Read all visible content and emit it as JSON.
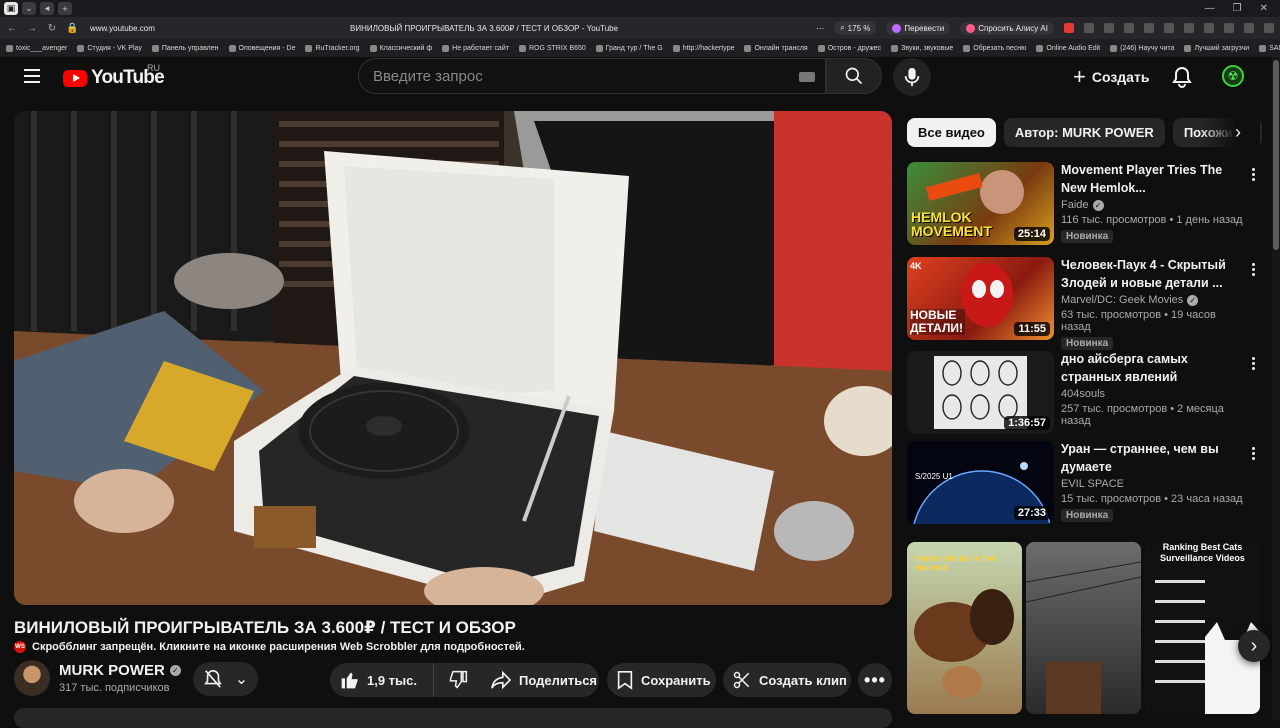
{
  "browser": {
    "url": "www.youtube.com",
    "page_title": "ВИНИЛОВЫЙ ПРОИГРЫВАТЕЛЬ ЗА 3.600₽ / ТЕСТ И ОБЗОР - YouTube",
    "zoom": "175 %",
    "translate_label": "Перевести",
    "alice_label": "Спросить Алису AI",
    "bookmarks": [
      "toxic___avenger",
      "Студия - VK Play",
      "Панель управлен",
      "Оповещения - De",
      "RuTracker.org",
      "Классический ф",
      "Не работает сайт",
      "ROG STRIX B650",
      "Гранд тур / The G",
      "http://hackertype",
      "Онлайн трансля",
      "Остров - дружес",
      "Звуки, звуковые",
      "Обрезать песню",
      "Online Audio Edit",
      "(246) Научу чита",
      "Лучший загрузчи",
      "SAN_VENCII"
    ]
  },
  "header": {
    "logo_text": "YouTube",
    "region": "RU",
    "search_placeholder": "Введите запрос",
    "create_label": "Создать"
  },
  "video": {
    "title": "ВИНИЛОВЫЙ ПРОИГРЫВАТЕЛЬ ЗА 3.600₽ / ТЕСТ И ОБЗОР",
    "scrobble_notice": "Скробблинг запрещён. Кликните на иконке расширения Web Scrobbler для подробностей.",
    "scrobble_icon_text": "WS",
    "channel_name": "MURK POWER",
    "subscribers": "317 тыс. подписчиков",
    "likes": "1,9 тыс.",
    "share_label": "Поделиться",
    "save_label": "Сохранить",
    "clip_label": "Создать клип"
  },
  "chips": [
    "Все видео",
    "Автор: MURK POWER",
    "Похожий к"
  ],
  "recommendations": [
    {
      "title": "Movement Player Tries The New Hemlok...",
      "channel": "Faide",
      "verified": true,
      "stats": "116 тыс. просмотров • 1 день назад",
      "badge": "Новинка",
      "duration": "25:14",
      "thumb_text": "HEMLOK MOVEMENT"
    },
    {
      "title": "Человек-Паук 4 - Скрытый Злодей и новые детали ...",
      "channel": "Marvel/DC: Geek Movies",
      "verified": true,
      "stats": "63 тыс. просмотров • 19 часов назад",
      "badge": "Новинка",
      "duration": "11:55",
      "thumb_text": "НОВЫЕ ДЕТАЛИ!"
    },
    {
      "title": "дно айсберга самых странных явлений",
      "channel": "404souls",
      "verified": false,
      "stats": "257 тыс. просмотров • 2 месяца назад",
      "badge": "",
      "duration": "1:36:57",
      "thumb_text": ""
    },
    {
      "title": "Уран — страннее, чем вы думаете",
      "channel": "EVIL SPACE",
      "verified": false,
      "stats": "15 тыс. просмотров • 23 часа назад",
      "badge": "Новинка",
      "duration": "27:33",
      "thumb_text": "S/2025 U1"
    }
  ],
  "shorts": [
    {
      "caption": "Horse defends in five seconds"
    },
    {
      "caption": ""
    },
    {
      "caption": "Ranking Best Cats Surveillance Videos"
    }
  ],
  "colors": {
    "accent": "#ff0000",
    "bg": "#0f0f0f",
    "chip": "#272727"
  }
}
